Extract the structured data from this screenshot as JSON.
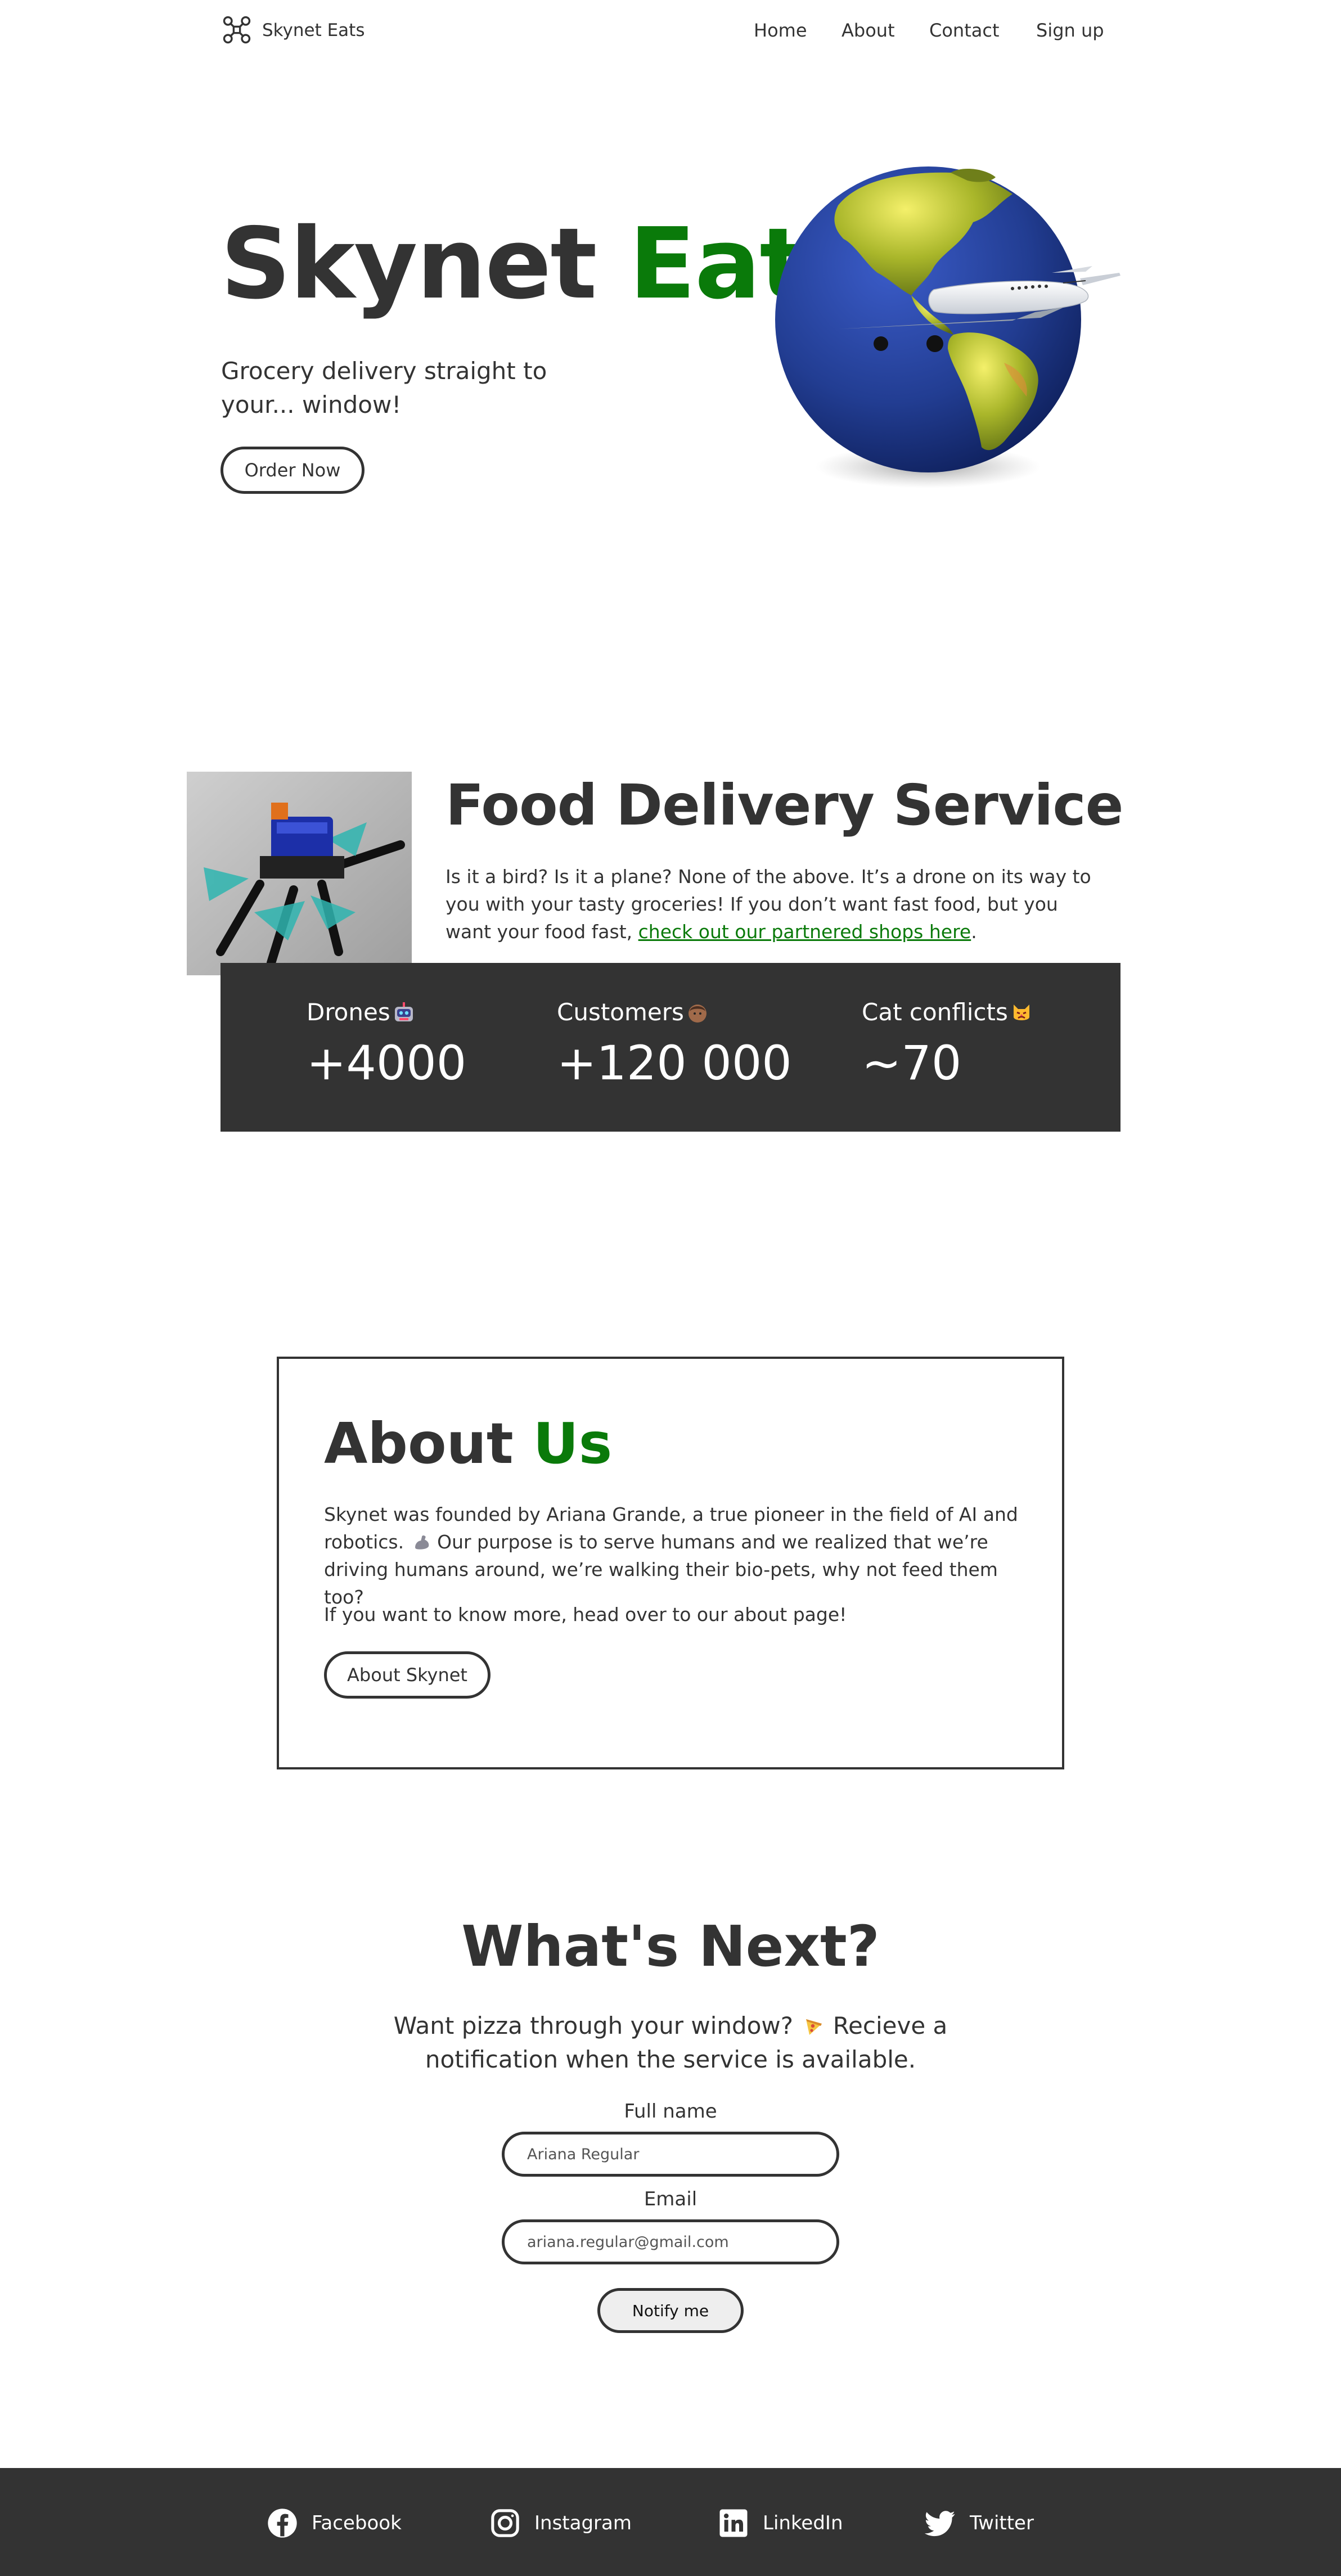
{
  "nav": {
    "brand": "Skynet Eats",
    "links": [
      "Home",
      "About",
      "Contact",
      "Sign up"
    ]
  },
  "hero": {
    "title_part1": "Skynet",
    "title_part2": "Eats",
    "subtitle": "Grocery delivery straight to your... window!",
    "button": "Order Now"
  },
  "service": {
    "title": "Food Delivery Service",
    "text": "Is it a bird? Is it a plane? None of the above. It’s a drone on its way to you with your tasty groceries! If you don’t want fast food, but you want your food fast,",
    "link": "check out our partnered shops here",
    "text_end": "."
  },
  "stats": [
    {
      "label": "Drones",
      "value": "+4000",
      "icon": "robot-emoji"
    },
    {
      "label": "Customers",
      "value": "+120 000",
      "icon": "person-emoji"
    },
    {
      "label": "Cat conflicts",
      "value": "~70",
      "icon": "pouting-cat-emoji"
    }
  ],
  "about": {
    "title_part1": "About",
    "title_part2": "Us",
    "p1_a": "Skynet was founded by Ariana Grande, a true pioneer in the field of AI and robotics.",
    "p1_b": "Our purpose is to serve humans and we realized that we’re driving humans around, we’re walking their bio-pets, why not feed them too?",
    "p2": "If you want to know more, head over to our about page!",
    "button": "About Skynet"
  },
  "next": {
    "title": "What's Next?",
    "subtitle_a": "Want pizza through your window?",
    "subtitle_b": "Recieve a notification when the service is available.",
    "name_label": "Full name",
    "name_value": "Ariana Regular",
    "email_label": "Email",
    "email_value": "ariana.regular@gmail.com",
    "button": "Notify me"
  },
  "footer": {
    "links": [
      "Facebook",
      "Instagram",
      "LinkedIn",
      "Twitter"
    ]
  },
  "colors": {
    "accent": "#0a7a0a",
    "dark": "#333333"
  }
}
